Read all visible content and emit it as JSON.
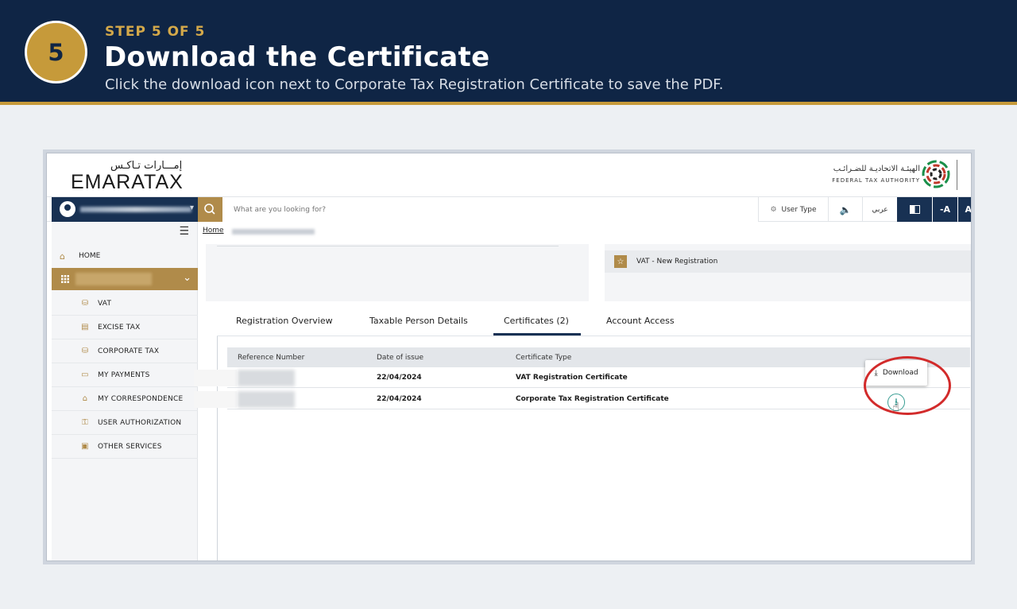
{
  "step": {
    "number": "5",
    "kicker": "STEP 5 OF 5",
    "title": "Download the Certificate",
    "subtitle": "Click the download icon next to Corporate Tax Registration Certificate to save the PDF."
  },
  "brand": {
    "emara_ar": "إمـــارات تـاكـس",
    "emara_en": "EMARATAX",
    "fta_ar": "الهيئـة الاتحاديـة للضـرائـب",
    "fta_en": "FEDERAL TAX AUTHORITY"
  },
  "topnav": {
    "search_placeholder": "What are you looking for?",
    "user_type": "User Type",
    "language": "عربي",
    "font_decrease": "-A",
    "font_increase": "A"
  },
  "sidebar": {
    "home": "HOME",
    "items": [
      {
        "label": "VAT"
      },
      {
        "label": "EXCISE TAX"
      },
      {
        "label": "CORPORATE TAX"
      },
      {
        "label": "MY PAYMENTS"
      },
      {
        "label": "MY CORRESPONDENCE"
      },
      {
        "label": "USER AUTHORIZATION"
      },
      {
        "label": "OTHER SERVICES"
      }
    ]
  },
  "breadcrumb": {
    "home": "Home"
  },
  "registration_card": {
    "label": "VAT - New Registration"
  },
  "tabs": [
    {
      "label": "Registration Overview"
    },
    {
      "label": "Taxable Person Details"
    },
    {
      "label": "Certificates (2)"
    },
    {
      "label": "Account Access"
    }
  ],
  "table": {
    "headers": [
      "Reference Number",
      "Date of issue",
      "Certificate Type"
    ],
    "rows": [
      {
        "date": "22/04/2024",
        "type": "VAT Registration Certificate"
      },
      {
        "date": "22/04/2024",
        "type": "Corporate Tax Registration Certificate"
      }
    ]
  },
  "download_tooltip": "Download",
  "colors": {
    "header_navy": "#0f2545",
    "gold": "#c69a3a",
    "portal_gold": "#b08b4a",
    "portal_navy": "#183153",
    "highlight_red": "#d22b2b"
  }
}
